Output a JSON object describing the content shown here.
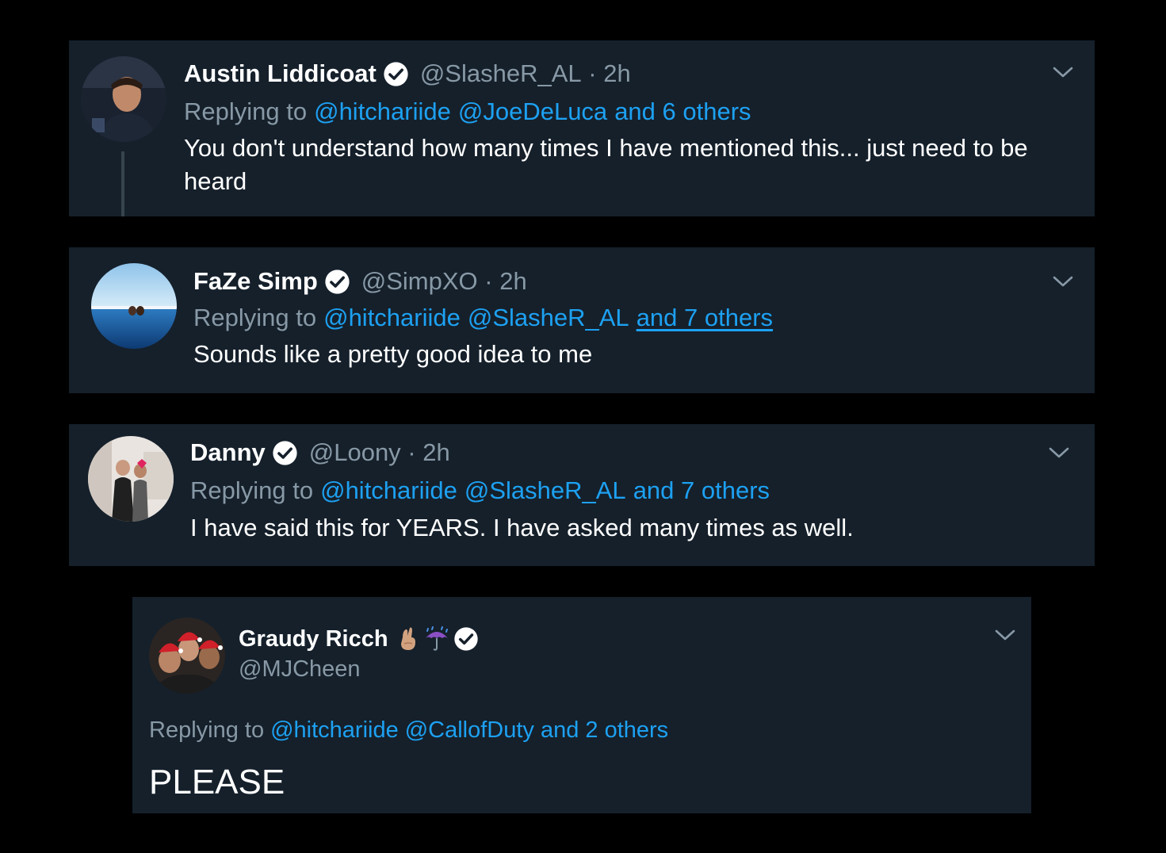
{
  "tweets": [
    {
      "name": "Austin Liddicoat",
      "handle": "@SlasheR_AL",
      "sep": " · ",
      "time": "2h",
      "reply_prefix": "Replying to",
      "reply_to": [
        "@hitchariide",
        "@JoeDeLuca",
        "and 6 others"
      ],
      "text": "You don't understand how many times I have mentioned this... just need to be heard"
    },
    {
      "name": "FaZe Simp",
      "handle": "@SimpXO",
      "sep": " · ",
      "time": "2h",
      "reply_prefix": "Replying to",
      "reply_to": [
        "@hitchariide",
        "@SlasheR_AL",
        "and 7 others"
      ],
      "text": "Sounds like a pretty good idea to me"
    },
    {
      "name": "Danny",
      "handle": "@Loony",
      "sep": " · ",
      "time": "2h",
      "reply_prefix": "Replying to",
      "reply_to": [
        "@hitchariide",
        "@SlasheR_AL",
        "and 7 others"
      ],
      "text": "I have said this for YEARS. I have asked many times as well."
    },
    {
      "name": "Graudy Ricch",
      "handle": "@MJCheen",
      "name_emojis": [
        "crossed-fingers-emoji",
        "umbrella-rain-emoji"
      ],
      "reply_prefix": "Replying to",
      "reply_to": [
        "@hitchariide",
        "@CallofDuty",
        "and 2 others"
      ],
      "text": "PLEASE"
    }
  ],
  "icons": {
    "verified": "verified-badge-icon",
    "more": "chevron-down-icon"
  },
  "colors": {
    "background": "#000000",
    "card": "#15202b",
    "link": "#1da1f2",
    "muted": "#8899a6",
    "text": "#ffffff"
  }
}
